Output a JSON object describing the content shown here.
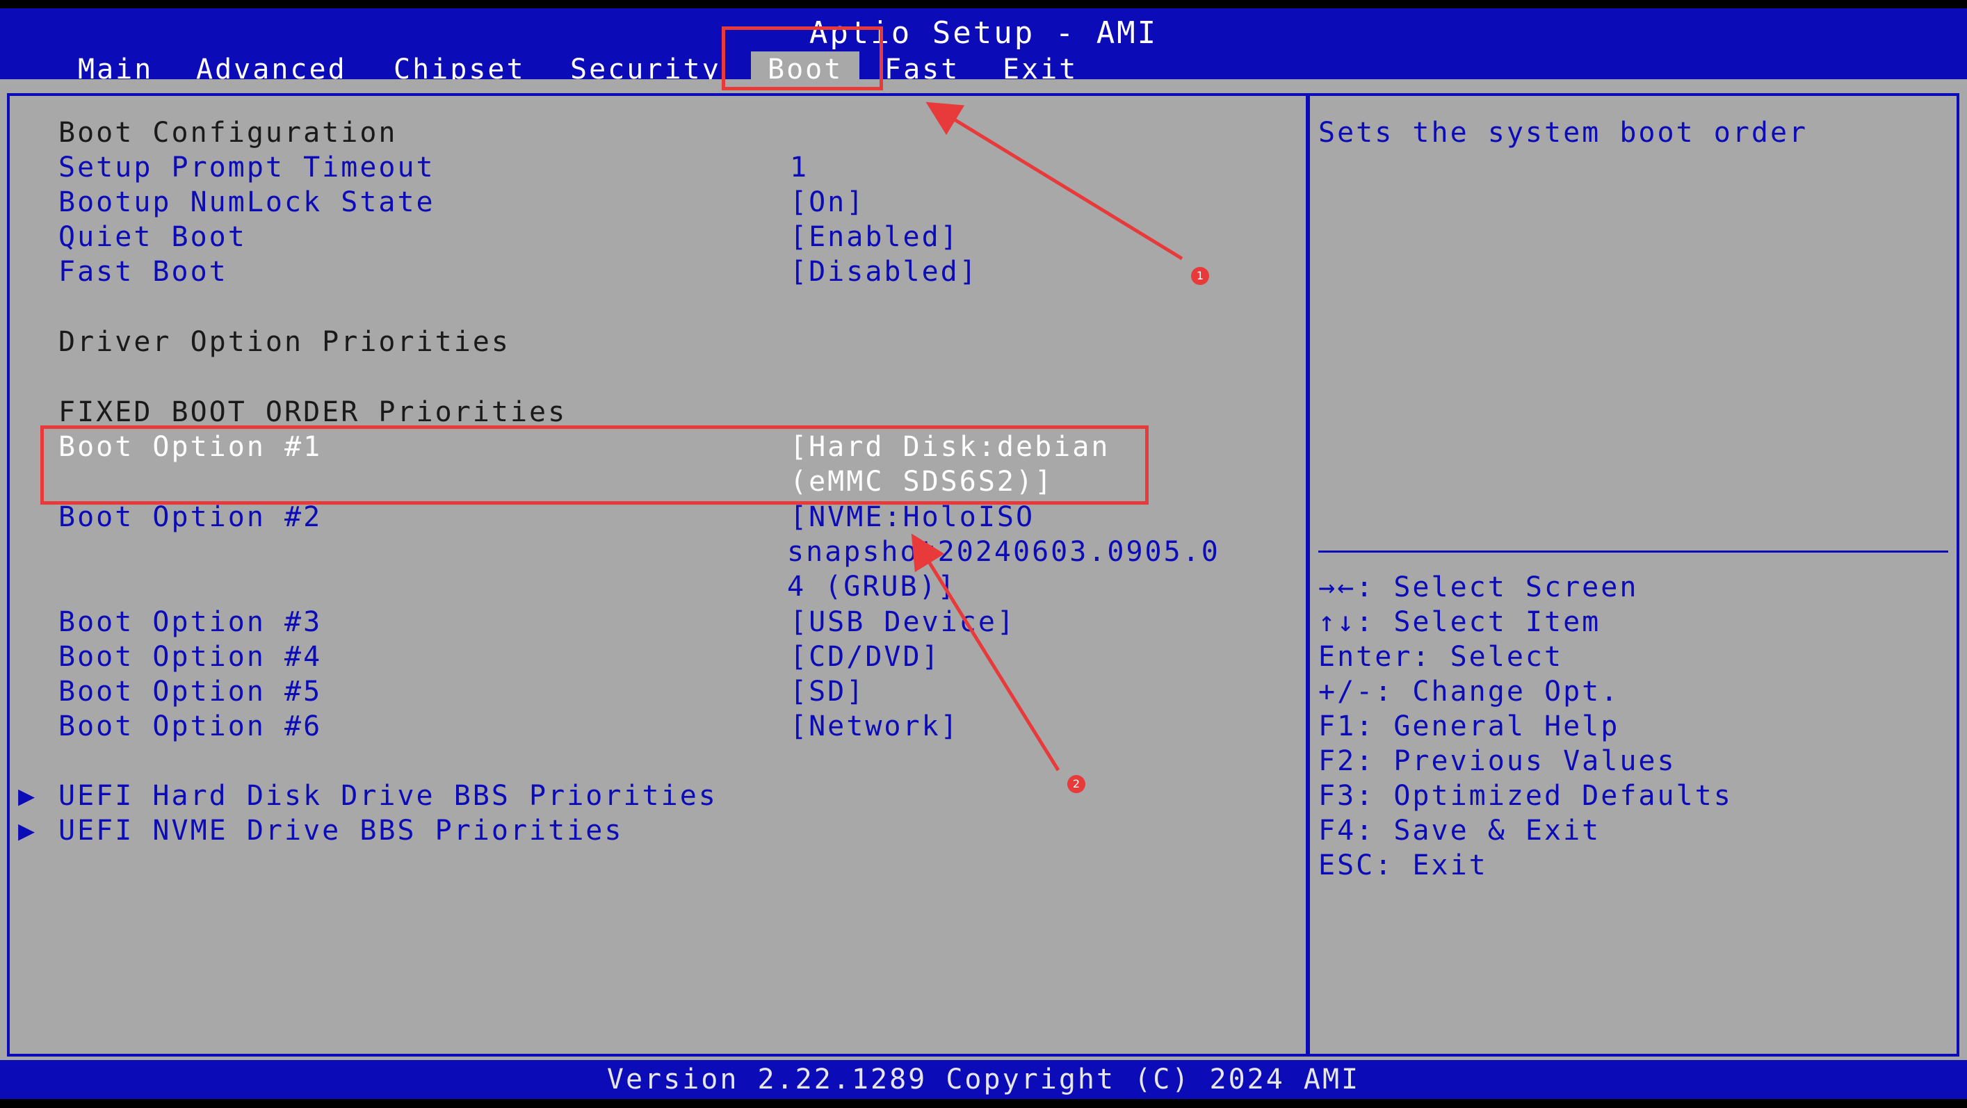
{
  "header": {
    "title": "Aptio Setup - AMI",
    "tabs": [
      {
        "label": "Main"
      },
      {
        "label": "Advanced"
      },
      {
        "label": "Chipset"
      },
      {
        "label": "Security"
      },
      {
        "label": "Boot",
        "active": true
      },
      {
        "label": "Fast"
      },
      {
        "label": "Exit"
      }
    ]
  },
  "boot": {
    "config_heading": "Boot Configuration",
    "settings": [
      {
        "label": "Setup Prompt Timeout",
        "value": "1"
      },
      {
        "label": "Bootup NumLock State",
        "value": "[On]"
      },
      {
        "label": "Quiet Boot",
        "value": "[Enabled]"
      },
      {
        "label": "Fast Boot",
        "value": "[Disabled]"
      }
    ],
    "driver_heading": "Driver Option Priorities",
    "fixed_heading": "FIXED BOOT ORDER Priorities",
    "options": [
      {
        "label": "Boot Option #1",
        "value_lines": [
          "[Hard Disk:debian",
          "(eMMC SDS6S2)]"
        ]
      },
      {
        "label": "Boot Option #2",
        "value_lines": [
          "[NVME:HoloISO",
          "snapshot20240603.0905.0",
          "4 (GRUB)]"
        ]
      },
      {
        "label": "Boot Option #3",
        "value_lines": [
          "[USB Device]"
        ]
      },
      {
        "label": "Boot Option #4",
        "value_lines": [
          "[CD/DVD]"
        ]
      },
      {
        "label": "Boot Option #5",
        "value_lines": [
          "[SD]"
        ]
      },
      {
        "label": "Boot Option #6",
        "value_lines": [
          "[Network]"
        ]
      }
    ],
    "submenus": [
      {
        "label": "UEFI Hard Disk Drive BBS Priorities"
      },
      {
        "label": "UEFI NVME Drive BBS Priorities"
      }
    ],
    "submenu_marker": "▶"
  },
  "help": {
    "description": "Sets the system boot order",
    "keys": [
      "→←: Select Screen",
      "↑↓: Select Item",
      "Enter: Select",
      "+/-: Change Opt.",
      "F1: General Help",
      "F2: Previous Values",
      "F3: Optimized Defaults",
      "F4: Save & Exit",
      "ESC: Exit"
    ]
  },
  "footer": {
    "version": "Version 2.22.1289 Copyright (C) 2024 AMI"
  },
  "annotations": {
    "badge1": "1",
    "badge2": "2",
    "color": "#e8393b"
  }
}
